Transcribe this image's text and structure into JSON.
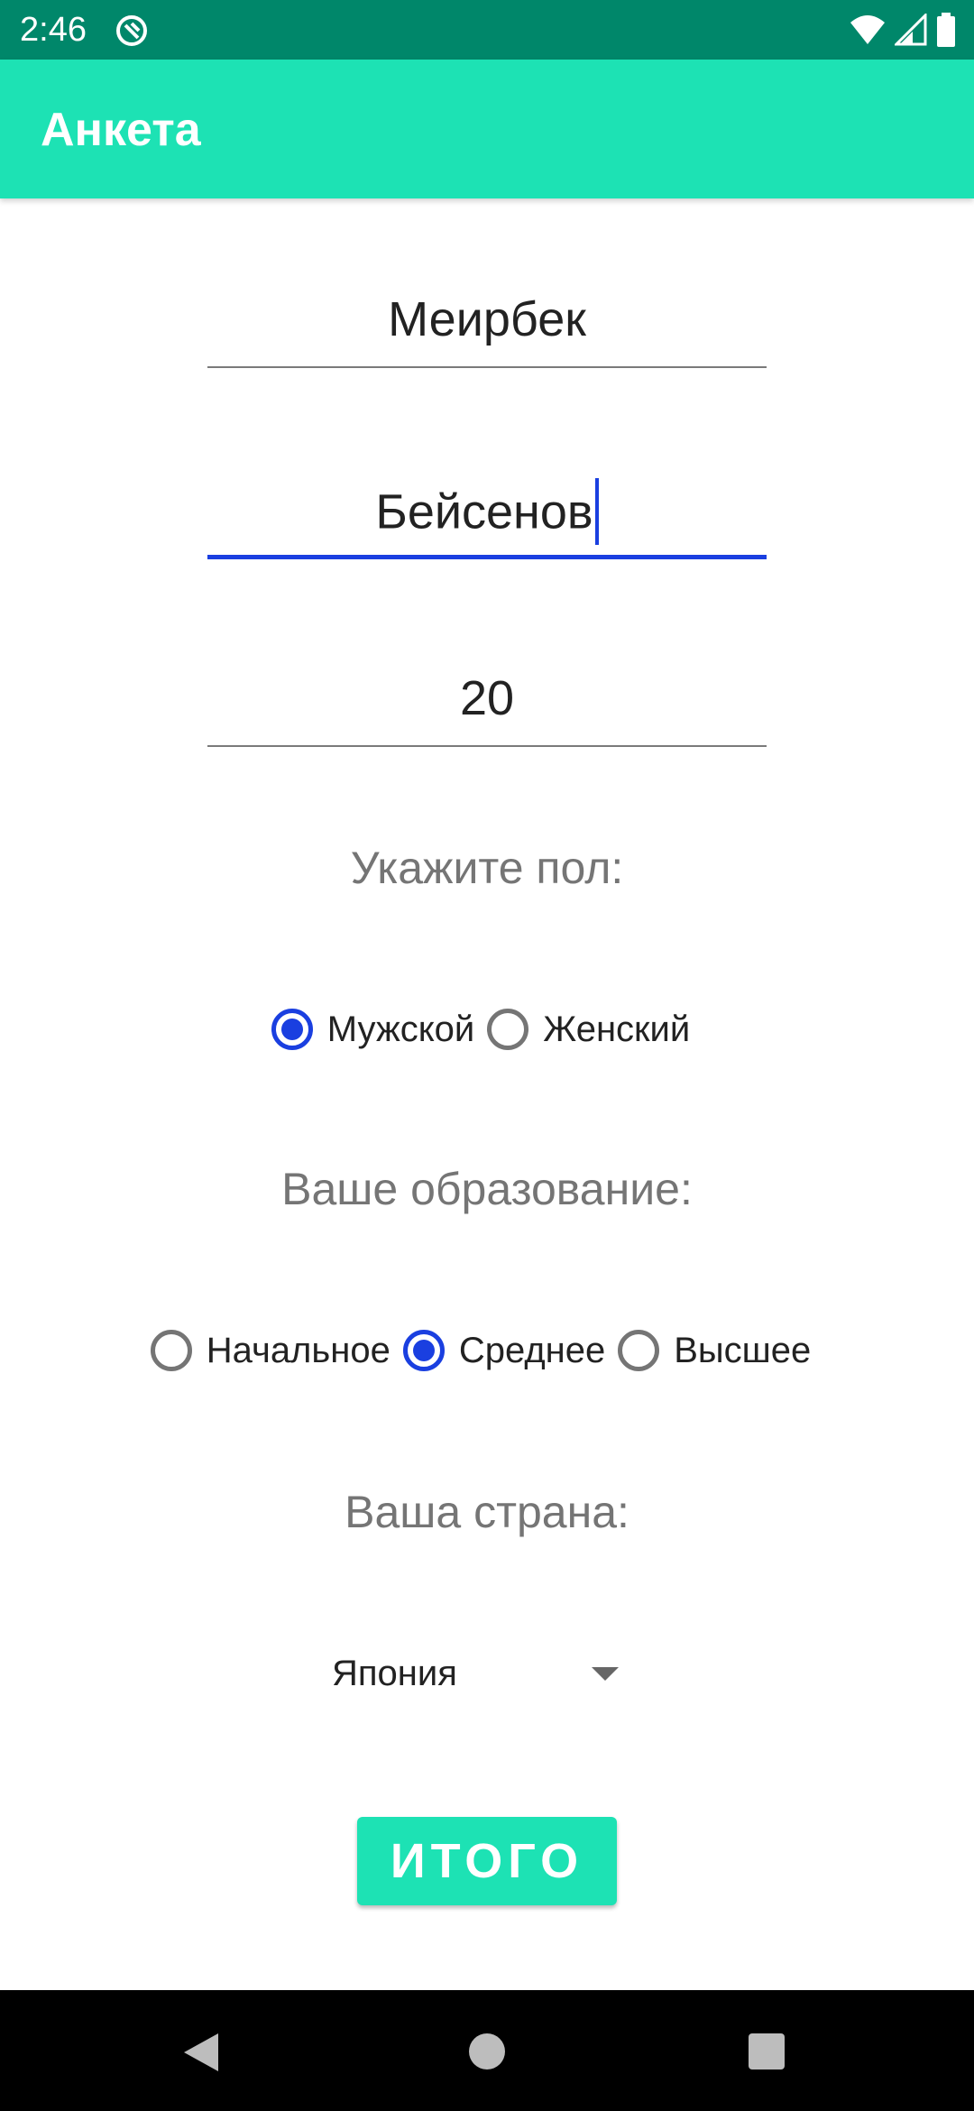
{
  "status_bar": {
    "time": "2:46",
    "icons": [
      "app-notification-icon",
      "wifi-icon",
      "signal-icon",
      "battery-icon"
    ]
  },
  "app_bar": {
    "title": "Анкета",
    "color": "#1de2b4"
  },
  "form": {
    "first_name": "Меирбек",
    "last_name": "Бейсенов",
    "age": "20",
    "gender": {
      "label": "Укажите пол:",
      "options": [
        "Мужской",
        "Женский"
      ],
      "selected": "Мужской"
    },
    "education": {
      "label": "Ваше образование:",
      "options": [
        "Начальное",
        "Среднее",
        "Высшее"
      ],
      "selected": "Среднее"
    },
    "country": {
      "label": "Ваша страна:",
      "selected": "Япония"
    },
    "submit_label": "ИТОГО"
  },
  "colors": {
    "status_bar": "#00876a",
    "accent": "#1a3fe0"
  },
  "nav_bar": {
    "icons": [
      "back-icon",
      "home-icon",
      "recents-icon"
    ]
  }
}
